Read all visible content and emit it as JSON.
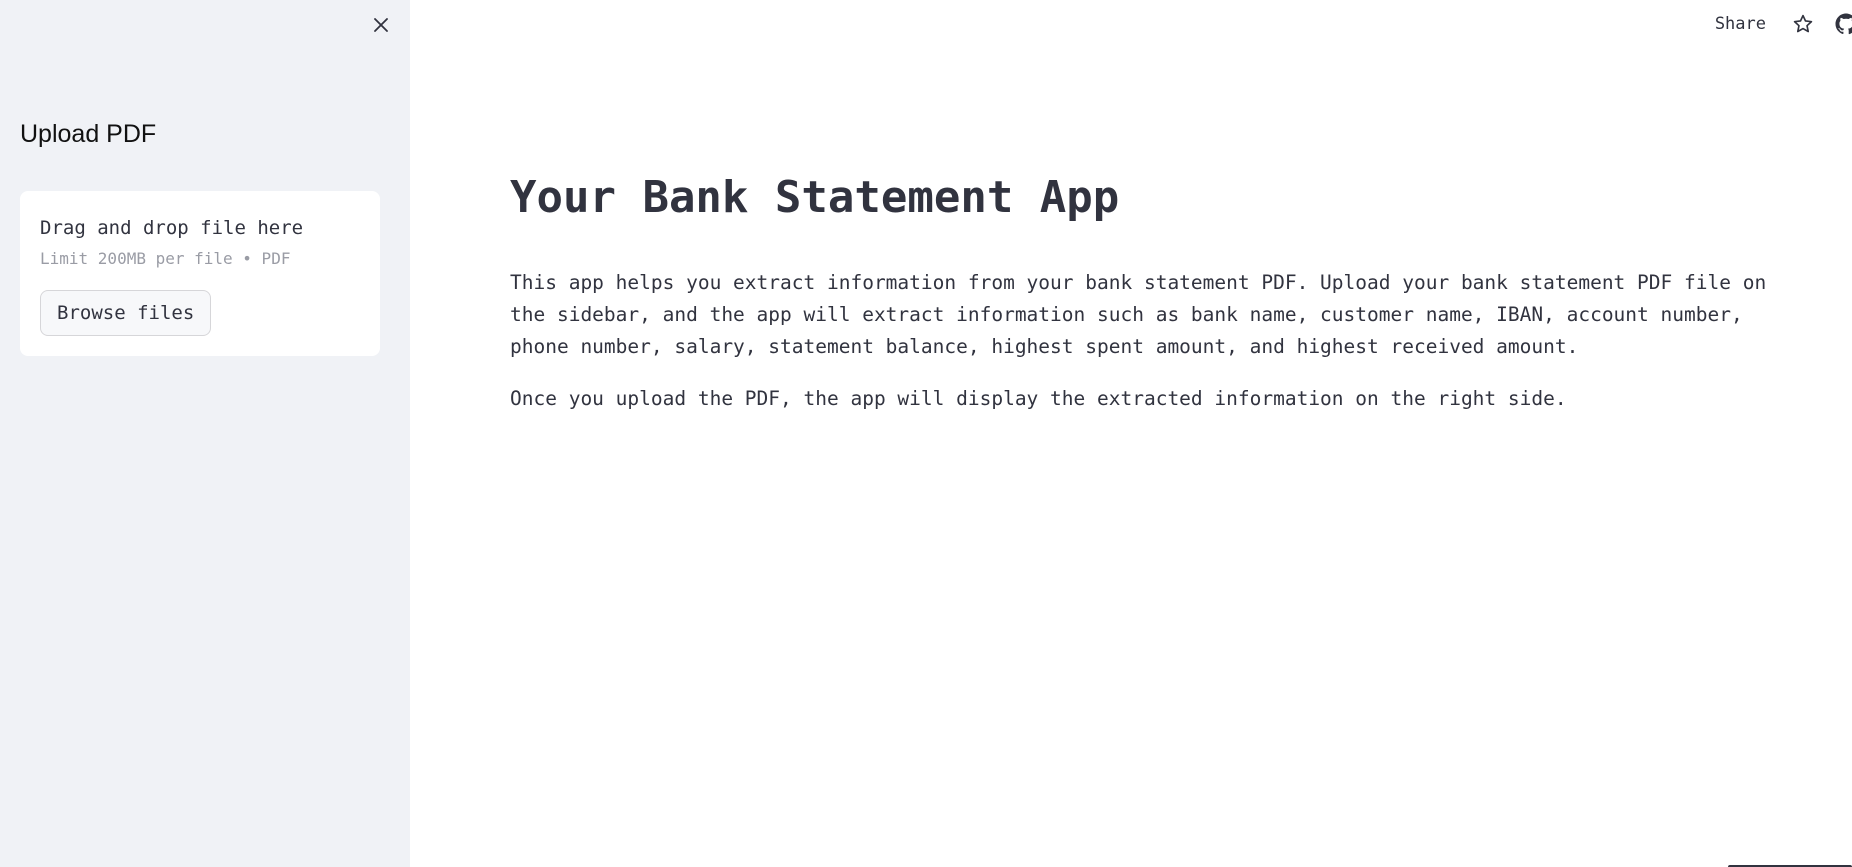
{
  "sidebar": {
    "title": "Upload PDF",
    "close_icon": "close-icon",
    "uploader": {
      "title": "Drag and drop file here",
      "subtitle": "Limit 200MB per file • PDF",
      "button_label": "Browse files"
    },
    "background": "#f0f2f6"
  },
  "header": {
    "share_label": "Share",
    "star_icon": "star-icon",
    "github_icon": "github-icon"
  },
  "main": {
    "title": "Your Bank Statement App",
    "paragraph1": "This app helps you extract information from your bank statement PDF. Upload your bank statement PDF file on the sidebar, and the app will extract information such as bank name, customer name, IBAN, account number, phone number, salary, statement balance, highest spent amount, and highest received amount.",
    "paragraph2": "Once you upload the PDF, the app will display the extracted information on the right side."
  },
  "colors": {
    "text": "#31333f",
    "muted": "#9a9ca5",
    "background": "#ffffff"
  }
}
